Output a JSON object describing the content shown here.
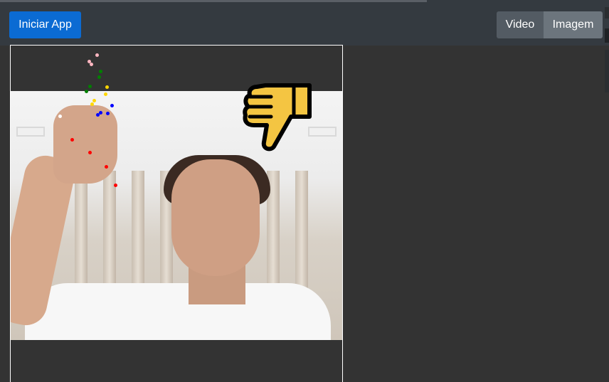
{
  "toolbar": {
    "start_label": "Iniciar App",
    "mode_options": [
      "Video",
      "Imagem"
    ],
    "selected_mode": "Imagem"
  },
  "result": {
    "gesture_icon": "thumbs-down-icon"
  },
  "colors": {
    "start_button": "#0b6bd3",
    "video_button": "#535b63",
    "imagem_button": "#6c757d",
    "emoji_fill": "#f4c542"
  }
}
